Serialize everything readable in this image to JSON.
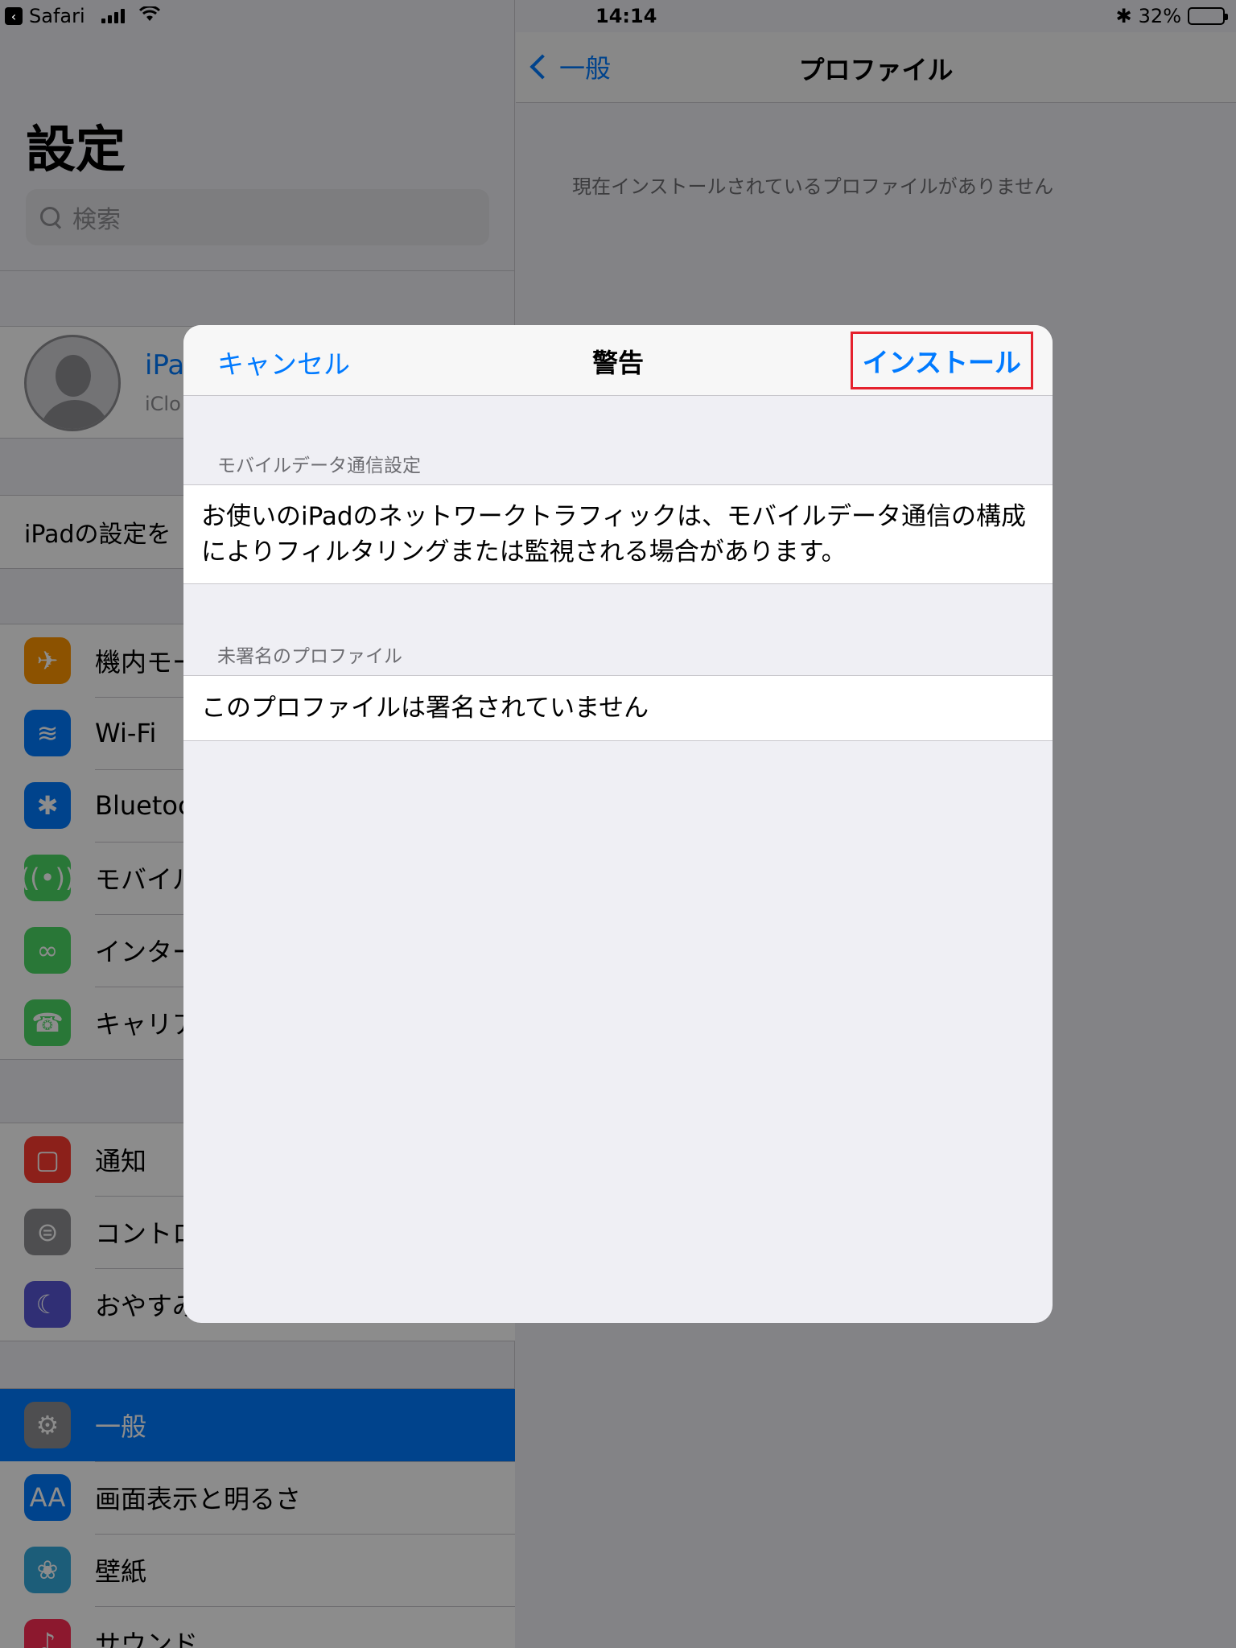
{
  "status_bar": {
    "back_app": "Safari",
    "time": "14:14",
    "battery_text": "32%",
    "battery_level": 0.32,
    "bluetooth_symbol": "✱"
  },
  "settings": {
    "title": "設定",
    "search_placeholder": "検索",
    "profile": {
      "name": "iPa",
      "subtitle": "iClo"
    },
    "setup_text": "iPadの設定を",
    "group1": [
      {
        "label": "機内モー",
        "icon": "airplane-icon",
        "color": "#ff9500",
        "glyph": "✈"
      },
      {
        "label": "Wi-Fi",
        "icon": "wifi-icon",
        "color": "#007aff",
        "glyph": "≋"
      },
      {
        "label": "Bluetoc",
        "icon": "bluetooth-icon",
        "color": "#007aff",
        "glyph": "✱"
      },
      {
        "label": "モバイル",
        "icon": "cellular-icon",
        "color": "#4cd964",
        "glyph": "((•))"
      },
      {
        "label": "インター",
        "icon": "personal-hotspot-icon",
        "color": "#4cd964",
        "glyph": "∞"
      },
      {
        "label": "キャリア",
        "icon": "phone-icon",
        "color": "#4cd964",
        "glyph": "☎"
      }
    ],
    "group2": [
      {
        "label": "通知",
        "icon": "notifications-icon",
        "color": "#ff3b30",
        "glyph": "▢"
      },
      {
        "label": "コントロ",
        "icon": "control-center-icon",
        "color": "#8e8e93",
        "glyph": "⊜"
      },
      {
        "label": "おやすみ",
        "icon": "do-not-disturb-icon",
        "color": "#5856d6",
        "glyph": "☾"
      }
    ],
    "group3": [
      {
        "label": "一般",
        "icon": "gear-icon",
        "color": "#8e8e93",
        "glyph": "⚙",
        "selected": true
      },
      {
        "label": "画面表示と明るさ",
        "icon": "display-brightness-icon",
        "color": "#007aff",
        "glyph": "AA"
      },
      {
        "label": "壁紙",
        "icon": "wallpaper-icon",
        "color": "#34aadc",
        "glyph": "❀"
      },
      {
        "label": "サウンド",
        "icon": "sounds-icon",
        "color": "#ff2d55",
        "glyph": "♪"
      }
    ]
  },
  "detail": {
    "back_label": "一般",
    "title": "プロファイル",
    "empty_message": "現在インストールされているプロファイルがありません"
  },
  "modal": {
    "cancel_label": "キャンセル",
    "title": "警告",
    "install_label": "インストール",
    "highlight_color": "#e5212d",
    "sections": [
      {
        "header": "モバイルデータ通信設定",
        "text": "お使いのiPadのネットワークトラフィックは、モバイルデータ通信の構成によりフィルタリングまたは監視される場合があります。"
      },
      {
        "header": "未署名のプロファイル",
        "text": "このプロファイルは署名されていません"
      }
    ]
  }
}
